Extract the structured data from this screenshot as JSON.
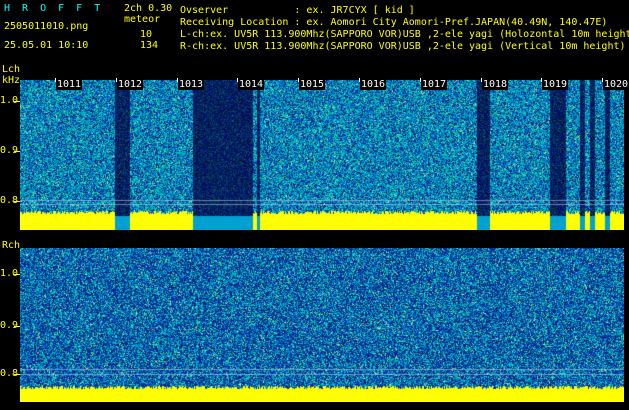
{
  "header": {
    "app_title": "H R O F F T",
    "version": "2ch 0.30",
    "filename": "2505011010.png",
    "meteor_label": "meteor",
    "meteor_count_l": "10",
    "meteor_count_r": "134",
    "datetime": "25.05.01 10:10",
    "observer": "Ovserver           : ex. JR7CYX [ kid ]",
    "location": "Receiving Location : ex. Aomori City Aomori-Pref.JAPAN(40.49N, 140.47E)",
    "lch_info": "L-ch:ex. UV5R 113.900Mhz(SAPPORO VOR)USB ,2-ele yagi (Holozontal 10m height",
    "rch_info": "R-ch:ex. UV5R 113.900Mhz(SAPPORO VOR)USB ,2-ele yagi (Vertical 10m height)"
  },
  "lch": {
    "channel_label": "Lch",
    "unit_label": "kHz",
    "y_labels": [
      "1.0",
      "0.9",
      "0.8"
    ]
  },
  "rch": {
    "channel_label": "Rch",
    "y_labels": [
      "1.0",
      "0.9",
      "0.8"
    ]
  },
  "minute_marks": [
    "1011",
    "1012",
    "1013",
    "1014",
    "1015",
    "1016",
    "1017",
    "1018",
    "1019",
    "1020"
  ],
  "colors": {
    "background": "#000000",
    "label_yellow": "#ffff00",
    "label_cyan": "#00ffff",
    "spectro_low": "#0a1a8a",
    "spectro_high": "#00c8a0",
    "carrier": "#ffff00"
  }
}
